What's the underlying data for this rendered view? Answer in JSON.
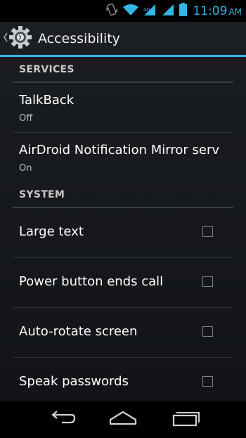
{
  "status_bar": {
    "time": "11:09",
    "ampm": "AM",
    "icons": [
      "vibrate-icon",
      "wifi-icon",
      "signal-icon",
      "signal-icon-2",
      "battery-icon"
    ]
  },
  "action_bar": {
    "title": "Accessibility",
    "app_icon": "settings-gear-icon",
    "up_icon": "up-caret-icon"
  },
  "sections": [
    {
      "header": "SERVICES",
      "items": [
        {
          "title": "TalkBack",
          "summary": "Off"
        },
        {
          "title": "AirDroid Notification Mirror servi",
          "summary": "On"
        }
      ]
    },
    {
      "header": "SYSTEM",
      "items": [
        {
          "title": "Large text",
          "checked": false
        },
        {
          "title": "Power button ends call",
          "checked": false
        },
        {
          "title": "Auto-rotate screen",
          "checked": false
        },
        {
          "title": "Speak passwords",
          "checked": false
        }
      ]
    }
  ],
  "nav_bar": {
    "buttons": [
      "back-icon",
      "home-icon",
      "recent-apps-icon"
    ]
  },
  "colors": {
    "accent": "#33b5e5",
    "background": "#16191c"
  }
}
